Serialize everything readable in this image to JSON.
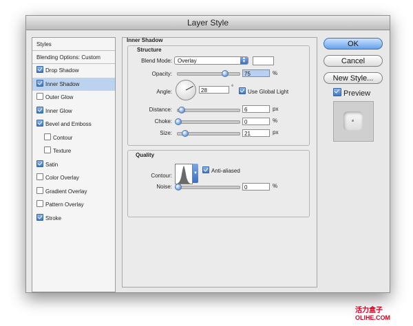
{
  "window": {
    "title": "Layer Style"
  },
  "styles": {
    "header": "Styles",
    "blending_options": "Blending Options: Custom",
    "items": [
      {
        "label": "Drop Shadow",
        "checked": true,
        "selected": false,
        "indent": false
      },
      {
        "label": "Inner Shadow",
        "checked": true,
        "selected": true,
        "indent": false
      },
      {
        "label": "Outer Glow",
        "checked": false,
        "selected": false,
        "indent": false
      },
      {
        "label": "Inner Glow",
        "checked": true,
        "selected": false,
        "indent": false
      },
      {
        "label": "Bevel and Emboss",
        "checked": true,
        "selected": false,
        "indent": false
      },
      {
        "label": "Contour",
        "checked": false,
        "selected": false,
        "indent": true
      },
      {
        "label": "Texture",
        "checked": false,
        "selected": false,
        "indent": true
      },
      {
        "label": "Satin",
        "checked": true,
        "selected": false,
        "indent": false
      },
      {
        "label": "Color Overlay",
        "checked": false,
        "selected": false,
        "indent": false
      },
      {
        "label": "Gradient Overlay",
        "checked": false,
        "selected": false,
        "indent": false
      },
      {
        "label": "Pattern Overlay",
        "checked": false,
        "selected": false,
        "indent": false
      },
      {
        "label": "Stroke",
        "checked": true,
        "selected": false,
        "indent": false
      }
    ]
  },
  "inner_shadow": {
    "title": "Inner Shadow",
    "structure": {
      "title": "Structure",
      "blend_mode": {
        "label": "Blend Mode:",
        "value": "Overlay",
        "swatch_color": "#ffffff"
      },
      "opacity": {
        "label": "Opacity:",
        "value": "75",
        "unit": "%",
        "percent": 75
      },
      "angle": {
        "label": "Angle:",
        "value": "28",
        "unit": "°",
        "degrees": 28
      },
      "use_global_light": {
        "label": "Use Global Light",
        "checked": true
      },
      "distance": {
        "label": "Distance:",
        "value": "6",
        "unit": "px",
        "level": 0.06
      },
      "choke": {
        "label": "Choke:",
        "value": "0",
        "unit": "%",
        "level": 0
      },
      "size": {
        "label": "Size:",
        "value": "21",
        "unit": "px",
        "level": 0.11
      }
    },
    "quality": {
      "title": "Quality",
      "contour": {
        "label": "Contour:"
      },
      "anti_aliased": {
        "label": "Anti-aliased",
        "checked": true
      },
      "noise": {
        "label": "Noise:",
        "value": "0",
        "unit": "%",
        "level": 0
      }
    }
  },
  "buttons": {
    "ok": "OK",
    "cancel": "Cancel",
    "new_style": "New Style..."
  },
  "preview": {
    "label": "Preview",
    "checked": true
  },
  "watermark": {
    "cn": "活力盒子",
    "en": "OLIHE.COM",
    "color": "#d8001f"
  }
}
